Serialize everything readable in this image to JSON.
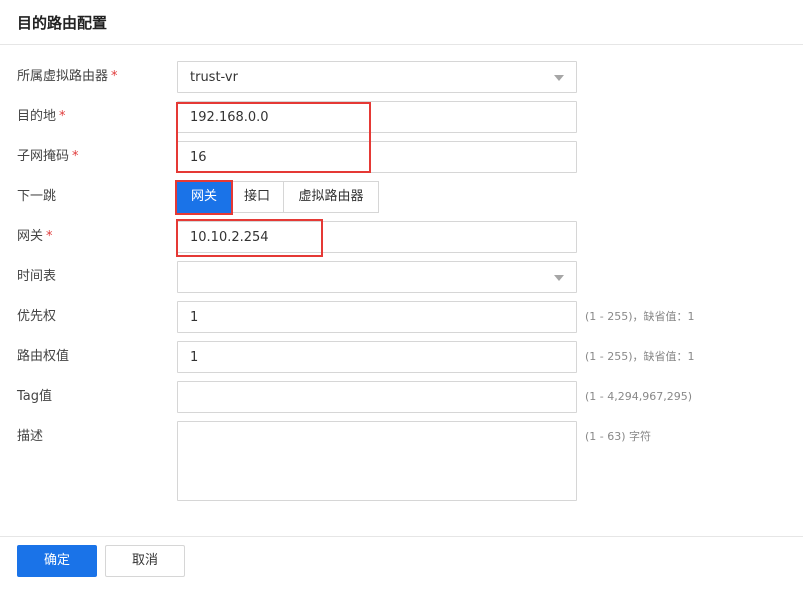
{
  "dialog": {
    "title": "目的路由配置"
  },
  "form": {
    "virtual_router": {
      "label": "所属虚拟路由器",
      "required": "*",
      "value": "trust-vr"
    },
    "destination": {
      "label": "目的地",
      "required": "*",
      "value": "192.168.0.0"
    },
    "subnet_mask": {
      "label": "子网掩码",
      "required": "*",
      "value": "16"
    },
    "next_hop": {
      "label": "下一跳",
      "options": [
        "网关",
        "接口",
        "虚拟路由器"
      ],
      "selected": "网关"
    },
    "gateway": {
      "label": "网关",
      "required": "*",
      "value": "10.10.2.254"
    },
    "schedule": {
      "label": "时间表",
      "value": ""
    },
    "priority": {
      "label": "优先权",
      "value": "1",
      "hint": "(1 - 255)，缺省值：1"
    },
    "route_weight": {
      "label": "路由权值",
      "value": "1",
      "hint": "(1 - 255)，缺省值：1"
    },
    "tag": {
      "label": "Tag值",
      "value": "",
      "hint": "(1 - 4,294,967,295)"
    },
    "description": {
      "label": "描述",
      "value": "",
      "hint": "(1 - 63) 字符"
    }
  },
  "footer": {
    "ok_label": "确定",
    "cancel_label": "取消"
  },
  "colors": {
    "primary": "#1a73e8",
    "required": "#e03a3a",
    "highlight": "#e53935"
  }
}
